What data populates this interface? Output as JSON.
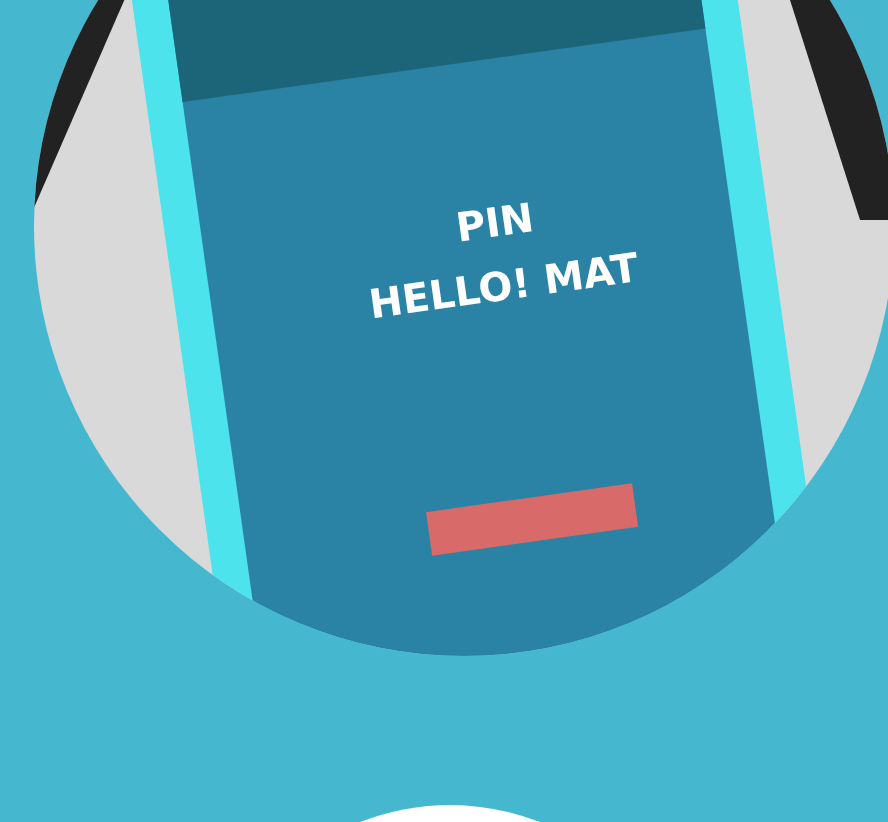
{
  "illustration": {
    "screen_lines": [
      "PIN",
      "HELLO! MAT"
    ]
  }
}
